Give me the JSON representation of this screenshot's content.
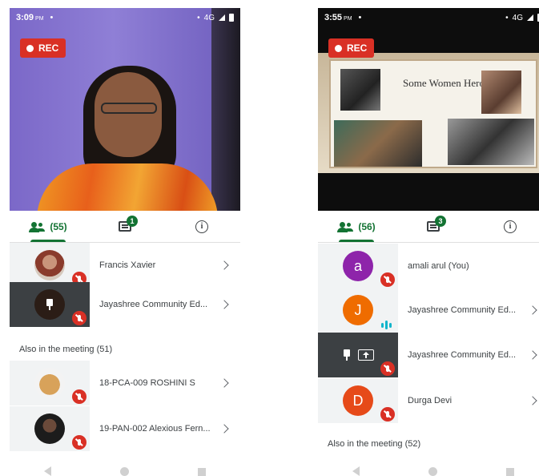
{
  "left": {
    "status": {
      "time": "3:09",
      "ampm": "PM",
      "network": "4G"
    },
    "rec_label": "REC",
    "tabs": {
      "people_count": "(55)",
      "chat_badge": "1"
    },
    "participants": [
      {
        "name": "Francis Xavier",
        "avatar": "photo",
        "muted": true
      },
      {
        "name": "Jayashree Community Ed...",
        "avatar": "pin",
        "muted": true
      }
    ],
    "section_label": "Also in the meeting (51)",
    "others": [
      {
        "name": "18-PCA-009 ROSHINI S",
        "avatar": "dog-photo",
        "muted": true
      },
      {
        "name": "19-PAN-002 Alexious Fern...",
        "avatar": "photo",
        "muted": true
      }
    ]
  },
  "right": {
    "status": {
      "time": "3:55",
      "ampm": "PM",
      "network": "4G"
    },
    "rec_label": "REC",
    "slide_title": "Some Women Heros",
    "tabs": {
      "people_count": "(56)",
      "chat_badge": "3"
    },
    "participants": [
      {
        "name": "amali arul (You)",
        "initial": "a",
        "color": "#8e24aa",
        "muted": true
      },
      {
        "name": "Jayashree Community Ed...",
        "initial": "J",
        "color": "#ef6c00",
        "speaking": true
      },
      {
        "name": "Jayashree Community Ed...",
        "avatar": "presenting",
        "muted": true
      },
      {
        "name": "Durga Devi",
        "initial": "D",
        "color": "#e64a19",
        "muted": true
      }
    ],
    "section_label": "Also in the meeting (52)"
  },
  "colors": {
    "accent": "#137333",
    "rec": "#d93025",
    "speaking": "#12b5cb"
  }
}
